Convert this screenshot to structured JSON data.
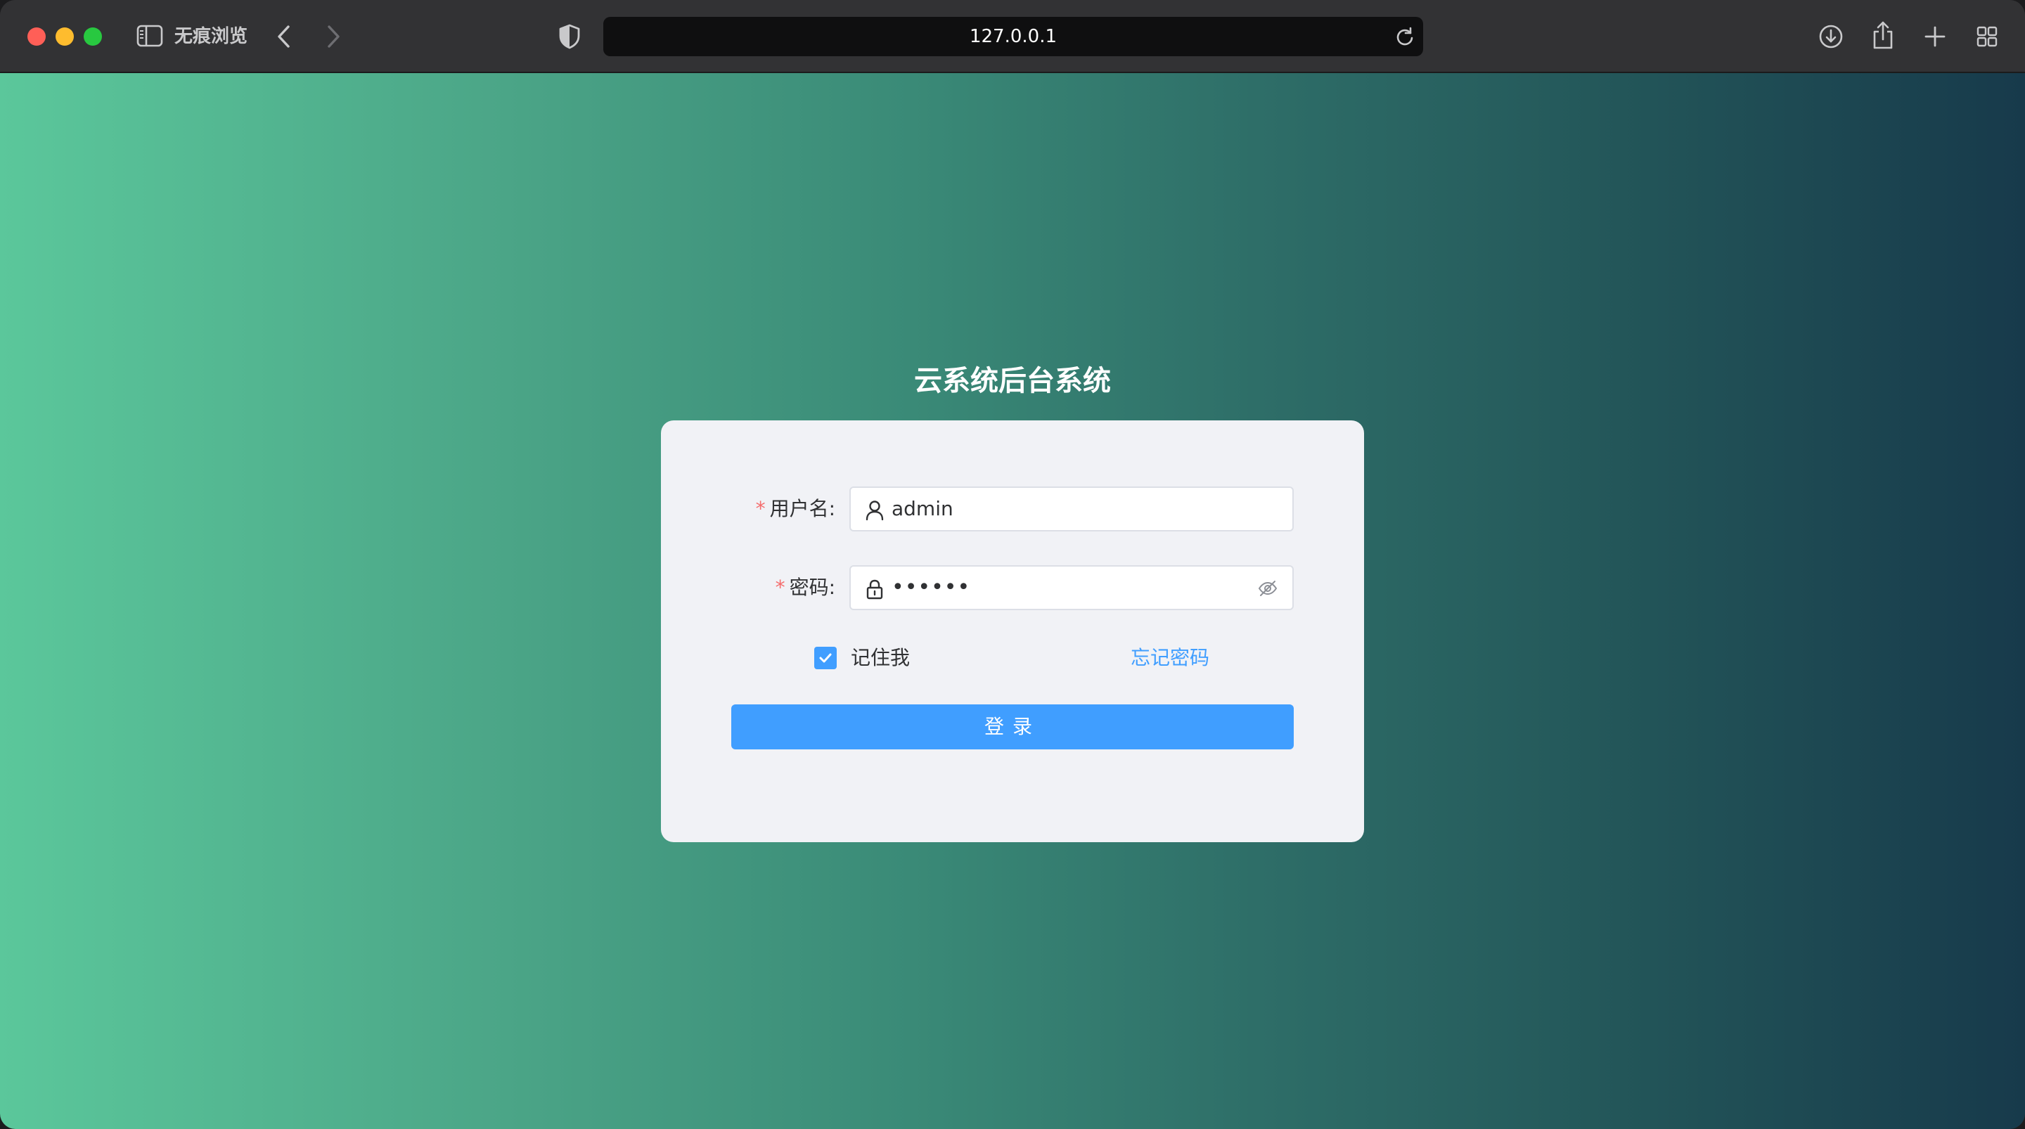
{
  "browser": {
    "incognito_label": "无痕浏览",
    "url": "127.0.0.1",
    "icons": [
      "sidebar-icon",
      "back-arrow-icon",
      "forward-arrow-icon",
      "shield-icon",
      "reload-icon",
      "download-icon",
      "share-icon",
      "plus-icon",
      "tab-overview-icon"
    ]
  },
  "page": {
    "title": "云系统后台系统"
  },
  "form": {
    "required_mark": "*",
    "username": {
      "label": "用户名:",
      "value": "admin",
      "icon": "user-icon"
    },
    "password": {
      "label": "密码:",
      "masked_value": "••••••",
      "icon": "lock-icon",
      "toggle_icon": "eye-hidden-icon"
    },
    "remember": {
      "label": "记住我",
      "checked": true
    },
    "forgot_link": "忘记密码",
    "submit_label": "登录"
  },
  "colors": {
    "primary": "#409eff",
    "required": "#f56c6c",
    "gradient_start": "#5bc79b",
    "gradient_end": "#173a4b",
    "card_bg": "#f1f2f6"
  }
}
